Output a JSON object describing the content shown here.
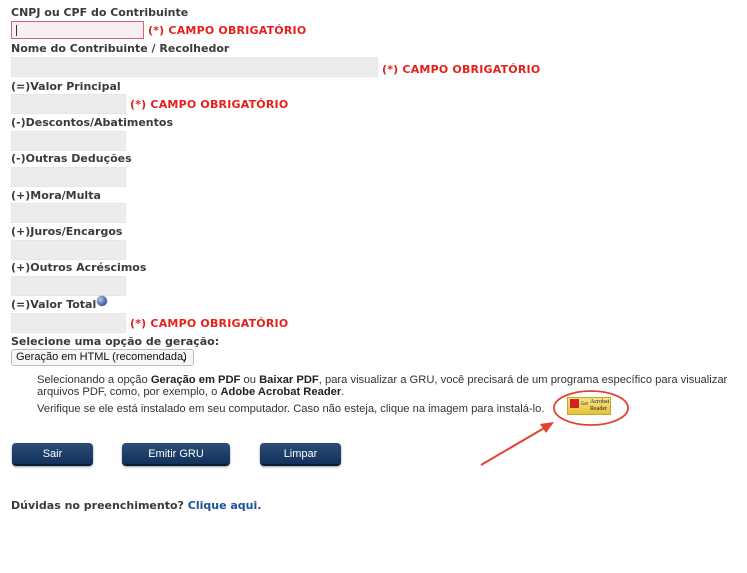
{
  "form": {
    "cnpj_label": "CNPJ ou CPF do Contribuinte",
    "cnpj_value": "",
    "nome_label": "Nome do Contribuinte / Recolhedor",
    "nome_value": "",
    "valor_principal_label": "(=)Valor Principal",
    "descontos_label": "(-)Descontos/Abatimentos",
    "outras_deducoes_label": "(-)Outras Deduções",
    "mora_label": "(+)Mora/Multa",
    "juros_label": "(+)Juros/Encargos",
    "outros_acrescimos_label": "(+)Outros Acréscimos",
    "valor_total_label": "(=)Valor Total",
    "required_text": "(*) CAMPO OBRIGATÓRIO"
  },
  "generation": {
    "label": "Selecione uma opção de geração:",
    "selected_option": "Geração em HTML (recomendada)",
    "info_part1": "Selecionando a opção ",
    "info_bold1": "Geração em PDF",
    "info_part2": " ou ",
    "info_bold2": "Baixar PDF",
    "info_part3": ", para visualizar a GRU, você precisará de um programa específico para visualizar",
    "info_line2_part1": "arquivos PDF, como, por exemplo, o ",
    "info_line2_bold": "Adobe Acrobat Reader",
    "info_line2_end": ".",
    "install_text": "Verifique se ele está instalado em seu computador. Caso não esteja, clique na imagem para instalá-lo.",
    "acrobat_line1": "Acrobat",
    "acrobat_line2": "Reader",
    "acrobat_get": "Get"
  },
  "buttons": {
    "sair": "Sair",
    "emitir": "Emitir GRU",
    "limpar": "Limpar"
  },
  "help": {
    "question": "Dúvidas no preenchimento?",
    "link": "Clique aqui."
  },
  "colors": {
    "required": "#e8201a",
    "button": "#1b3a66",
    "annotation": "#e0442f",
    "link": "#1a4f9c"
  },
  "icons": {
    "help_icon": "question-circle",
    "acrobat_icon": "adobe-acrobat-reader-badge"
  }
}
